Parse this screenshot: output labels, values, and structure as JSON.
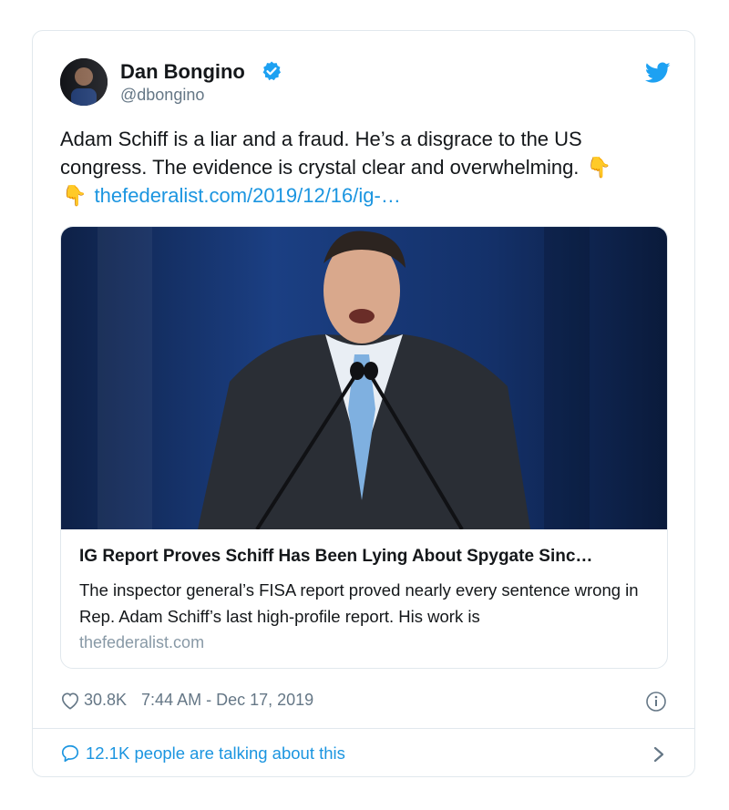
{
  "author": {
    "name": "Dan Bongino",
    "handle": "@dbongino",
    "verified": true
  },
  "tweet": {
    "text_before_emoji": "Adam Schiff is a liar and a fraud. He’s a disgrace to the US congress. The evidence is crystal clear and overwhelming.",
    "emoji_1": "👇",
    "emoji_2": "👇",
    "link": "thefederalist.com/2019/12/16/ig-…"
  },
  "card": {
    "title": "IG Report Proves Schiff Has Been Lying About Spygate Sinc…",
    "description": "The inspector general’s FISA report proved nearly every sentence wrong in Rep. Adam Schiff’s last high-profile report. His work is",
    "domain": "thefederalist.com"
  },
  "meta": {
    "likes": "30.8K",
    "timestamp": "7:44 AM - Dec 17, 2019"
  },
  "footer": {
    "talking": "12.1K people are talking about this"
  },
  "icons": {
    "verified": "verified-badge-icon",
    "logo": "twitter-bird-icon",
    "like": "heart-icon",
    "info": "info-icon",
    "reply": "speech-bubble-icon",
    "chevron": "chevron-right-icon"
  },
  "colors": {
    "link": "#1b95e0",
    "secondary": "#657786",
    "border": "#e1e8ed"
  }
}
